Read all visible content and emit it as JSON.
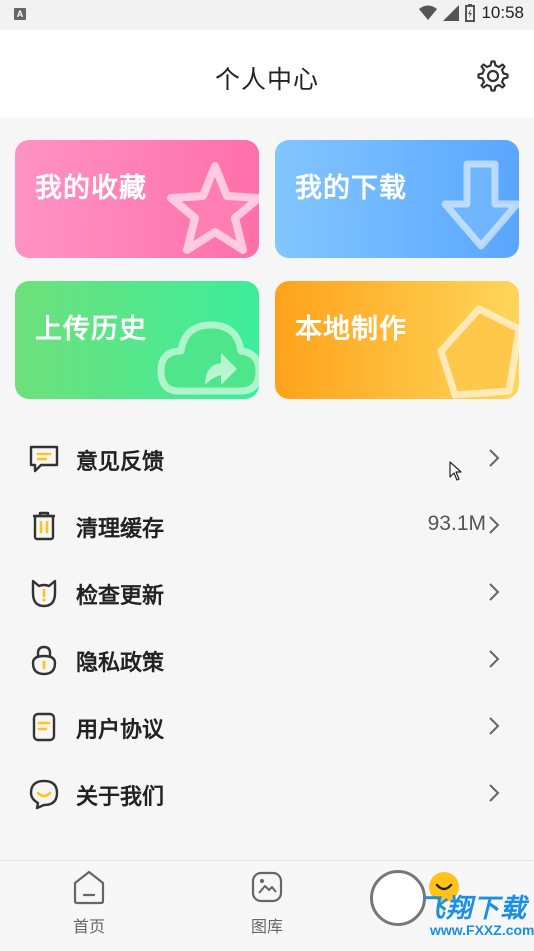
{
  "statusbar": {
    "time": "10:58",
    "notif_letter": "A"
  },
  "header": {
    "title": "个人中心",
    "settings_icon": "gear-icon"
  },
  "cards": [
    {
      "label": "我的收藏",
      "icon": "star-icon"
    },
    {
      "label": "我的下载",
      "icon": "download-arrow-icon"
    },
    {
      "label": "上传历史",
      "icon": "cloud-upload-icon"
    },
    {
      "label": "本地制作",
      "icon": "pentagon-icon"
    }
  ],
  "menu": [
    {
      "label": "意见反馈",
      "icon": "feedback-icon",
      "value": ""
    },
    {
      "label": "清理缓存",
      "icon": "trash-icon",
      "value": "93.1M"
    },
    {
      "label": "检查更新",
      "icon": "update-icon",
      "value": ""
    },
    {
      "label": "隐私政策",
      "icon": "lock-icon",
      "value": ""
    },
    {
      "label": "用户协议",
      "icon": "document-icon",
      "value": ""
    },
    {
      "label": "关于我们",
      "icon": "chat-smile-icon",
      "value": ""
    }
  ],
  "tabs": [
    {
      "label": "首页",
      "icon": "home-icon"
    },
    {
      "label": "图库",
      "icon": "gallery-icon"
    },
    {
      "label": "",
      "icon": "profile-smile-icon"
    }
  ],
  "watermark": {
    "brand": "飞翔下载",
    "url": "www.FXXZ.com"
  },
  "colors": {
    "accent": "#ffc31a",
    "fav": "#ff7fb5",
    "download": "#6fb6ff",
    "upload": "#4fe58a",
    "local": "#ffb52b"
  }
}
